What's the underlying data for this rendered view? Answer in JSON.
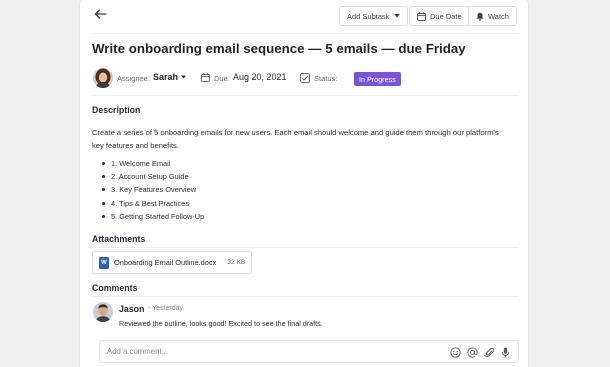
{
  "toolbar": {
    "add_subtask_label": "Add Subtask",
    "due_date_label": "Due Date",
    "watch_label": "Watch"
  },
  "task": {
    "title": "Write onboarding email sequence — 5 emails — due Friday",
    "assignee_label": "Assignee:",
    "assignee_name": "Sarah",
    "due_label": "Due:",
    "due_value": "Aug 20, 2021",
    "status_label": "Status:",
    "status_value": "In Progress"
  },
  "description": {
    "heading": "Description",
    "text": "Create a series of 5 onboarding emails for new users. Each email should welcome and guide them through our platform's key features and benefits.",
    "items": [
      "1. Welcome Email",
      "2. Account Setup Guide",
      "3. Key Features Overview",
      "4. Tips & Best Practices",
      "5. Getting Started Follow-Up"
    ]
  },
  "attachments": {
    "heading": "Attachments",
    "files": [
      {
        "icon_letter": "W",
        "name": "Onboarding Email Outline.docx",
        "size": "32 KB"
      }
    ]
  },
  "comments": {
    "heading": "Comments",
    "items": [
      {
        "author": "Jason",
        "time": "- Yesterday",
        "text": "Reviewed the outline, looks good! Excited to see the final drafts."
      }
    ],
    "compose_placeholder": "Add a comment..."
  },
  "colors": {
    "accent_purple": "#7b55d8",
    "word_blue": "#2b5fb4"
  },
  "icons": [
    "back-arrow-icon",
    "chevron-down-icon",
    "calendar-icon",
    "bell-icon",
    "checkbox-icon",
    "word-doc-icon",
    "emoji-icon",
    "at-icon",
    "paperclip-icon",
    "microphone-icon"
  ]
}
